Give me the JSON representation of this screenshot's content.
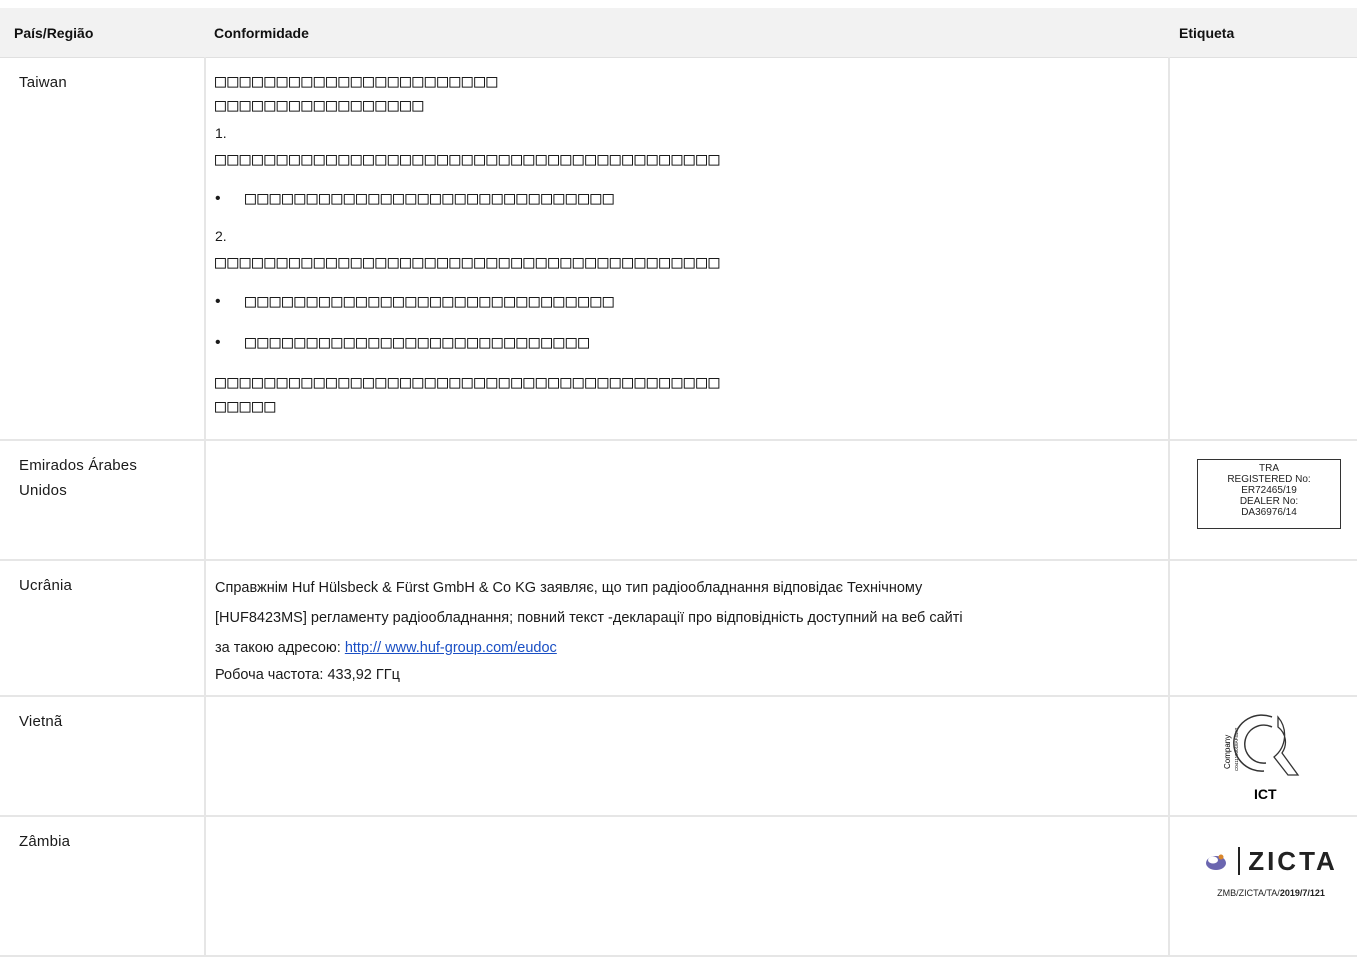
{
  "header": {
    "country": "País/Região",
    "compliance": "Conformidade",
    "label": "Etiqueta"
  },
  "rows": {
    "taiwan": {
      "country": "Taiwan",
      "lines": [
        "□□□□□□□□□□□□□□□□□□□□□□□",
        "□□□□□□□□□□□□□□□□□"
      ],
      "num1": "1.",
      "para1": "□□□□□□□□□□□□□□□□□□□□□□□□□□□□□□□□□□□□□□□□□",
      "bullet1": "□□□□□□□□□□□□□□□□□□□□□□□□□□□□□□",
      "num2": "2.",
      "para2": "□□□□□□□□□□□□□□□□□□□□□□□□□□□□□□□□□□□□□□□□□",
      "bullet2": "□□□□□□□□□□□□□□□□□□□□□□□□□□□□□□",
      "bullet3": "□□□□□□□□□□□□□□□□□□□□□□□□□□□□",
      "para3a": "□□□□□□□□□□□□□□□□□□□□□□□□□□□□□□□□□□□□□□□□□",
      "para3b": "□□□□□"
    },
    "uae": {
      "country": "Emirados Árabes Unidos",
      "tra": {
        "l1": "TRA",
        "l2": "REGISTERED No:",
        "l3": "ER72465/19",
        "l4": "DEALER No:",
        "l5": "DA36976/14"
      }
    },
    "ukraine": {
      "country": "Ucrânia",
      "line1": "Справжнім Huf Hülsbeck & Fürst GmbH & Co KG заявляє, що тип радіообладнання відповідає Технічному",
      "line2": "[HUF8423MS] регламенту радіообладнання; повний текст -декларації про відповідність доступний на веб сайті",
      "line3": "за такою адресою: ",
      "link": "http:// www.huf-group.com/eudoc",
      "line4": "Робоча частота: 433,92 ГГц"
    },
    "vietnam": {
      "country": "Vietnã",
      "ict": {
        "company": "Company",
        "code": "C0411100018AF4442",
        "mark": "ICT"
      }
    },
    "zambia": {
      "country": "Zâmbia",
      "zicta": {
        "name": "ZICTA",
        "code_prefix": "ZMB/ZICTA/TA/",
        "code_suffix": "2019/7/121"
      }
    }
  }
}
